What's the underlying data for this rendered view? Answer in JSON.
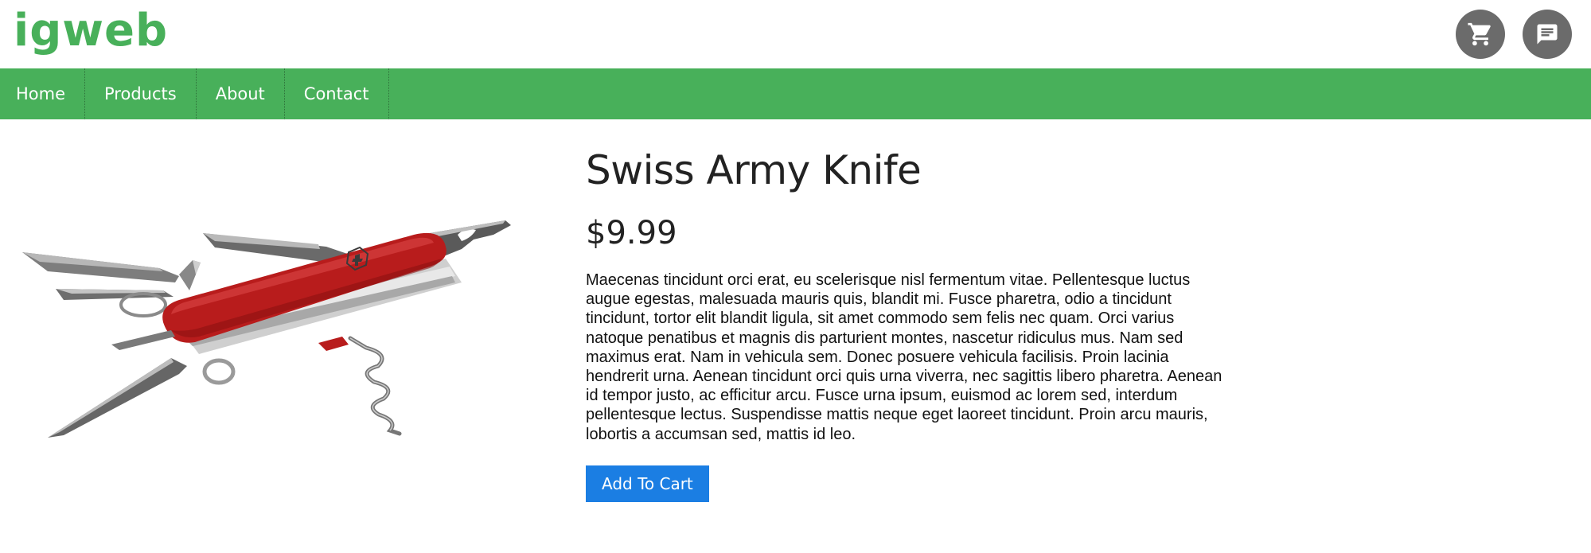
{
  "colors": {
    "brand_green": "#48b05a",
    "nav_green": "#48b05a",
    "icon_circle": "#6b6b6b",
    "button_blue": "#1b7ee3",
    "knife_red": "#b81c1c"
  },
  "header": {
    "logo": "igweb",
    "icons": [
      "cart-icon",
      "chat-icon"
    ]
  },
  "nav": {
    "items": [
      {
        "label": "Home"
      },
      {
        "label": "Products"
      },
      {
        "label": "About"
      },
      {
        "label": "Contact"
      }
    ]
  },
  "product": {
    "image_subject": "swiss-army-knife",
    "title": "Swiss Army Knife",
    "price": "$9.99",
    "description": "Maecenas tincidunt orci erat, eu scelerisque nisl fermentum vitae. Pellentesque luctus augue egestas, malesuada mauris quis, blandit mi. Fusce pharetra, odio a tincidunt tincidunt, tortor elit blandit ligula, sit amet commodo sem felis nec quam. Orci varius natoque penatibus et magnis dis parturient montes, nascetur ridiculus mus. Nam sed maximus erat. Nam in vehicula sem. Donec posuere vehicula facilisis. Proin lacinia hendrerit urna. Aenean tincidunt orci quis urna viverra, nec sagittis libero pharetra. Aenean id tempor justo, ac efficitur arcu. Fusce urna ipsum, euismod ac lorem sed, interdum pellentesque lectus. Suspendisse mattis neque eget laoreet tincidunt. Proin arcu mauris, lobortis a accumsan sed, mattis id leo.",
    "add_to_cart_label": "Add To Cart"
  }
}
